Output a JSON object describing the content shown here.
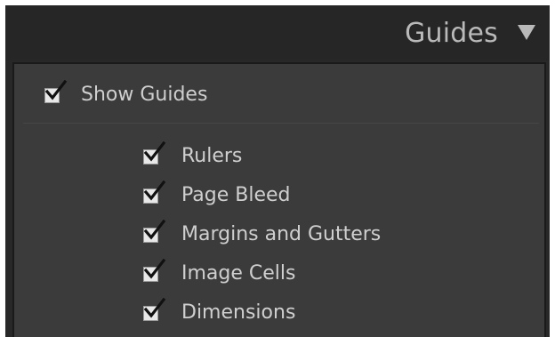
{
  "panel": {
    "title": "Guides",
    "collapse_icon": "triangle-down-icon"
  },
  "colors": {
    "panel_header_bg": "#262626",
    "panel_body_bg": "#3b3b3b",
    "text": "#cfcfcf",
    "title_text": "#b9b9b9",
    "checkbox_bg": "#e8e8e8",
    "check_color": "#111111"
  },
  "show_guides": {
    "label": "Show Guides",
    "checked": true
  },
  "options": [
    {
      "label": "Rulers",
      "checked": true
    },
    {
      "label": "Page Bleed",
      "checked": true
    },
    {
      "label": "Margins and Gutters",
      "checked": true
    },
    {
      "label": "Image Cells",
      "checked": true
    },
    {
      "label": "Dimensions",
      "checked": true
    }
  ]
}
